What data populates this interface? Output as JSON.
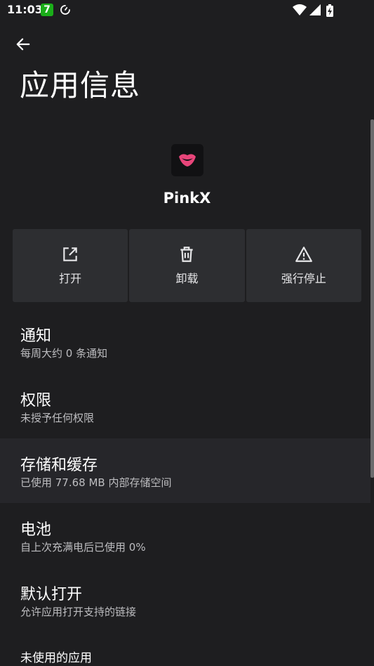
{
  "status_bar": {
    "time": "11:03",
    "badge": "7"
  },
  "page": {
    "title": "应用信息"
  },
  "app": {
    "name": "PinkX",
    "icon": "pink-lips-icon",
    "icon_color": "#e8457a"
  },
  "actions": [
    {
      "label": "打开",
      "icon": "open-external-icon"
    },
    {
      "label": "卸载",
      "icon": "trash-icon"
    },
    {
      "label": "强行停止",
      "icon": "warning-icon"
    }
  ],
  "list": [
    {
      "title": "通知",
      "summary": "每周大约 0 条通知"
    },
    {
      "title": "权限",
      "summary": "未授予任何权限"
    },
    {
      "title": "存储和缓存",
      "summary": "已使用 77.68 MB 内部存储空间"
    },
    {
      "title": "电池",
      "summary": "自上次充满电后已使用 0%"
    },
    {
      "title": "默认打开",
      "summary": "允许应用打开支持的链接"
    },
    {
      "title": "未使用的应用",
      "summary": ""
    }
  ]
}
